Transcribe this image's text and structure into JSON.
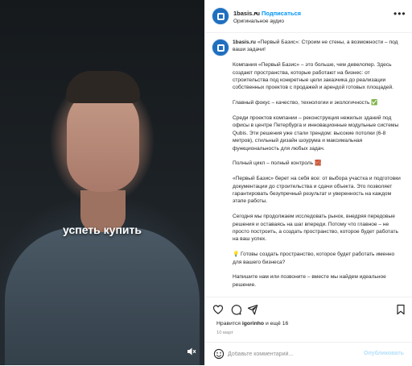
{
  "video": {
    "overlay_text": "успеть купить",
    "sound_icon": "speaker-muted-icon"
  },
  "header": {
    "username": "1basis.ru",
    "separator": "•",
    "follow_label": "Подписаться",
    "audio_label": "Оригинальное аудио",
    "more_icon": "more-horizontal-icon"
  },
  "caption": {
    "username": "1basis.ru",
    "paragraphs": [
      "«Первый Базис»: Строим не стены, а возможности – под ваши задачи!",
      "Компания «Первый Базис» – это больше, чем девелопер. Здесь создают пространства, которые работают на бизнес: от строительства под конкретные цели заказчика до реализации собственных проектов с продажей и арендой готовых площадей.",
      "Главный фокус – качество, технологии и экологичность ✅",
      "Среди проектов компании – реконструкция нежилых зданий под офисы в центре Петербурга и инновационные модульные системы Qubis. Эти решения уже стали трендом: высокие потолки (6-8 метров), стильный дизайн шоурума и максимальная функциональность для любых задач.",
      "Полный цикл – полный контроль 🧱",
      "«Первый Базис» берет на себя все: от выбора участка и подготовки документации до строительства и сдачи объекта. Это позволяет гарантировать безупречный результат и уверенность на каждом этапе работы.",
      "Сегодня мы продолжаем исследовать рынок, внедряя передовые решения и оставаясь на шаг впереди. Потому что главное – не просто построить, а создать пространство, которое будет работать на ваш успех.",
      "💡 Готовы создать пространство, которое будет работать именно для вашего бизнеса?",
      "Напишите нам или позвоните – вместе мы найдем идеальное решение."
    ]
  },
  "actions": {
    "like_icon": "heart-icon",
    "comment_icon": "comment-icon",
    "share_icon": "send-icon",
    "save_icon": "bookmark-icon"
  },
  "likes": {
    "prefix": "Нравится",
    "user": "igorinho",
    "suffix": "и ещё 16"
  },
  "date": "10 март",
  "comment": {
    "emoji_icon": "emoji-icon",
    "placeholder": "Добавьте комментарий...",
    "post_label": "Опубликовать"
  },
  "colors": {
    "accent": "#0095f6",
    "post_disabled": "#b2dffc",
    "avatar_bg": "#1f6fbf"
  }
}
